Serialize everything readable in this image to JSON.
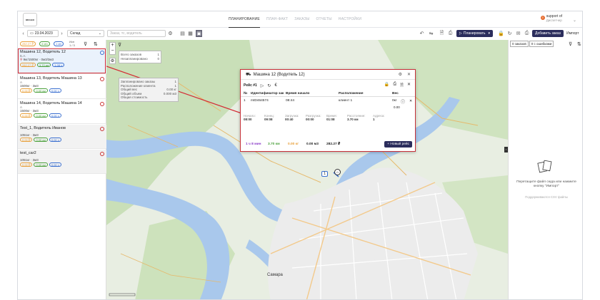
{
  "header": {
    "logo": "IMOGEO",
    "nav": [
      "ПЛАНИРОВАНИЕ",
      "ПЛАН-ФАКТ",
      "ЗАКАЗЫ",
      "ОТЧЕТЫ",
      "НАСТРОЙКИ"
    ],
    "user_name": "support of",
    "user_role": "Диспетчер",
    "badge": "0"
  },
  "toolbar": {
    "date": "23.04.2023",
    "warehouse": "Склад",
    "search_placeholder": "Заказ, тс, водитель",
    "plan_button": "Планировать",
    "add_order_button": "Добавить заказ",
    "import_label": "Импорт"
  },
  "stats": {
    "a": "282.27 ₽",
    "b": "4 м/с",
    "c": "1 мн",
    "d_label": "Исп",
    "d_value": "1 / 3"
  },
  "vehicles": [
    {
      "title": "Машина 12, Водитель 12",
      "sub": "Б.А.",
      "load": "9кг/1500кг · 0м3/3м3",
      "tags": [
        "282.27 ₽",
        "3.70 км",
        "1.08 ч"
      ],
      "selected": true
    },
    {
      "title": "Машина 13, Водитель Машина 13",
      "sub": "А",
      "load": "1500кг · 3м3",
      "tags": [
        "0.00 ₽",
        "0.00 км",
        "0.00 ч"
      ],
      "selected": false
    },
    {
      "title": "Машина 14, Водитель Машина 14",
      "sub": "А",
      "load": "1500кг · 3м3",
      "tags": [
        "0.00 ₽",
        "0.00 км",
        "0.00 ч"
      ],
      "selected": false
    },
    {
      "title": "Test_1, Водитель Иванов",
      "sub": "",
      "load": "1051кг · 3м3",
      "tags": [
        "0.00 ₽",
        "0.00 км",
        "0.00 ч"
      ],
      "selected": false
    },
    {
      "title": "test_car2",
      "sub": "",
      "load": "1051кг · 3м3",
      "tags": [
        "0.00 ₽",
        "0.00 км",
        "0.00 ч"
      ],
      "selected": false
    }
  ],
  "map_tooltip": {
    "rows": [
      [
        "Всего заказов",
        "1"
      ],
      [
        "Незапланировано",
        "0"
      ]
    ]
  },
  "map_tooltip2": {
    "rows": [
      [
        "Запланировано заказы",
        "1"
      ],
      [
        "Расположение клиента",
        "1"
      ],
      [
        "Общий вес",
        "0.00 кг"
      ],
      [
        "Общий объем",
        "0.000 м3"
      ],
      [
        "Общая стоимость",
        ""
      ]
    ]
  },
  "popup": {
    "title": "Машина 12 (Водитель 12)",
    "trip": "Рейс #1",
    "columns": [
      "№",
      "Идентификатор зак",
      "Время начало",
      "Расположение",
      "Вес"
    ],
    "row": [
      "1",
      "mtD464574",
      "08:44",
      "клиент 1",
      "0кг"
    ],
    "weight_extra": "0.00",
    "metrics": [
      {
        "label": "Начало:",
        "value": "08:00"
      },
      {
        "label": "Конец:",
        "value": "09:08"
      },
      {
        "label": "Загрузка:",
        "value": "00:40"
      },
      {
        "label": "Разгрузка:",
        "value": "00:00"
      },
      {
        "label": "Время:",
        "value": "01:08"
      },
      {
        "label": "Расстояние:",
        "value": "3.70 км"
      },
      {
        "label": "Адреса:",
        "value": "1"
      }
    ],
    "footer": [
      "1 ч 8 мин",
      "3.70 км",
      "0.00 кг",
      "0.00 м3",
      "282.27 ₽"
    ],
    "new_trip": "+ Новый рейс"
  },
  "right_panel": {
    "tabs": [
      "0 заказов",
      "0 с ошибками"
    ],
    "drop_text": "Перетащите файл сюда или нажмите кнопку \"Импорт\"",
    "drop_sub": "Поддерживаются CSV файлы"
  },
  "map_labels": {
    "city": "Самара",
    "marker": "1"
  },
  "colors": {
    "accent": "#2b2d5c",
    "selection": "#d42b34",
    "orange": "#e8a03a",
    "green": "#4aa03a",
    "blue": "#3a6fd0"
  }
}
